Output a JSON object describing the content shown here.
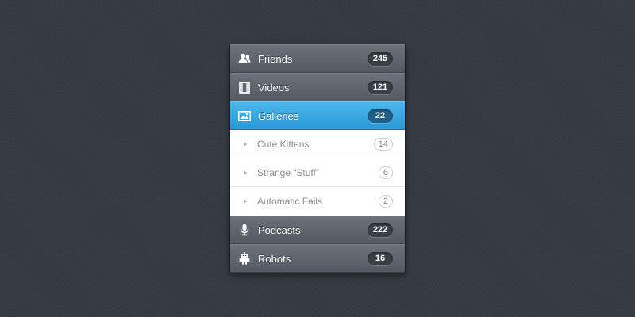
{
  "menu": {
    "friends": {
      "label": "Friends",
      "count": "245",
      "icon": "friends-icon"
    },
    "videos": {
      "label": "Videos",
      "count": "121",
      "icon": "film-icon"
    },
    "galleries": {
      "label": "Galleries",
      "count": "22",
      "icon": "image-icon",
      "state": "active",
      "subitems": [
        {
          "label": "Cute Kittens",
          "count": "14"
        },
        {
          "label": "Strange “Stuff”",
          "count": "6"
        },
        {
          "label": "Automatic Fails",
          "count": "2"
        }
      ]
    },
    "podcasts": {
      "label": "Podcasts",
      "count": "222",
      "icon": "microphone-icon"
    },
    "robots": {
      "label": "Robots",
      "count": "16",
      "icon": "robot-icon"
    }
  },
  "colors": {
    "background": "#363a42",
    "item": "#5f646d",
    "active": "#3aa8e1",
    "submenu": "#ffffff"
  }
}
